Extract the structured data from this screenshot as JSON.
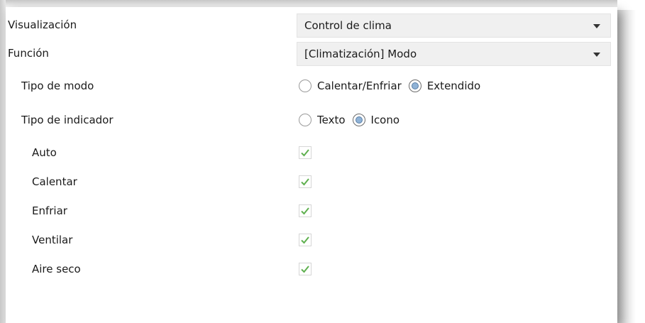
{
  "visualizacion": {
    "label": "Visualización",
    "value": "Control de clima"
  },
  "funcion": {
    "label": "Función",
    "value": "[Climatización] Modo"
  },
  "tipo_modo": {
    "label": "Tipo de modo",
    "options": [
      {
        "label": "Calentar/Enfriar",
        "selected": false
      },
      {
        "label": "Extendido",
        "selected": true
      }
    ]
  },
  "tipo_indicador": {
    "label": "Tipo de indicador",
    "options": [
      {
        "label": "Texto",
        "selected": false
      },
      {
        "label": "Icono",
        "selected": true
      }
    ]
  },
  "modos": [
    {
      "label": "Auto",
      "checked": true
    },
    {
      "label": "Calentar",
      "checked": true
    },
    {
      "label": "Enfriar",
      "checked": true
    },
    {
      "label": "Ventilar",
      "checked": true
    },
    {
      "label": "Aire seco",
      "checked": true
    }
  ],
  "colors": {
    "check": "#5fb04f",
    "radio_selected": "#8fb2d6",
    "select_bg": "#f0f0f0"
  }
}
